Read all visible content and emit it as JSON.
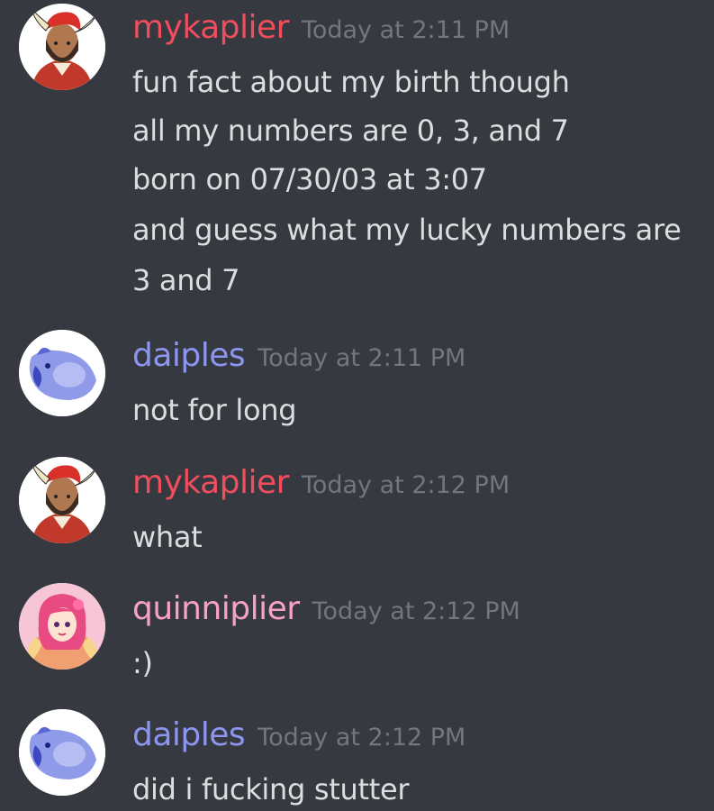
{
  "colors": {
    "background": "#36393f",
    "mykaplier": "#f04d5d",
    "daiples": "#8c95f0",
    "quinniplier": "#f7a0c8",
    "timestamp": "#72767d",
    "text": "#dcddde"
  },
  "messages": [
    {
      "author": "mykaplier",
      "timestamp": "Today at 2:11 PM",
      "avatar_icon": "horned-man-avatar",
      "lines": [
        "fun fact about my birth though",
        "all my numbers are 0, 3, and 7",
        "born on 07/30/03 at 3:07",
        "and guess what my lucky numbers are",
        "3 and 7"
      ]
    },
    {
      "author": "daiples",
      "timestamp": "Today at 2:11 PM",
      "avatar_icon": "blue-cat-avatar",
      "lines": [
        "not for long"
      ]
    },
    {
      "author": "mykaplier",
      "timestamp": "Today at 2:12 PM",
      "avatar_icon": "horned-man-avatar",
      "lines": [
        "what"
      ]
    },
    {
      "author": "quinniplier",
      "timestamp": "Today at 2:12 PM",
      "avatar_icon": "pink-doll-avatar",
      "lines": [
        ":)"
      ]
    },
    {
      "author": "daiples",
      "timestamp": "Today at 2:12 PM",
      "avatar_icon": "blue-cat-avatar",
      "lines": [
        "did i fucking stutter"
      ]
    }
  ]
}
